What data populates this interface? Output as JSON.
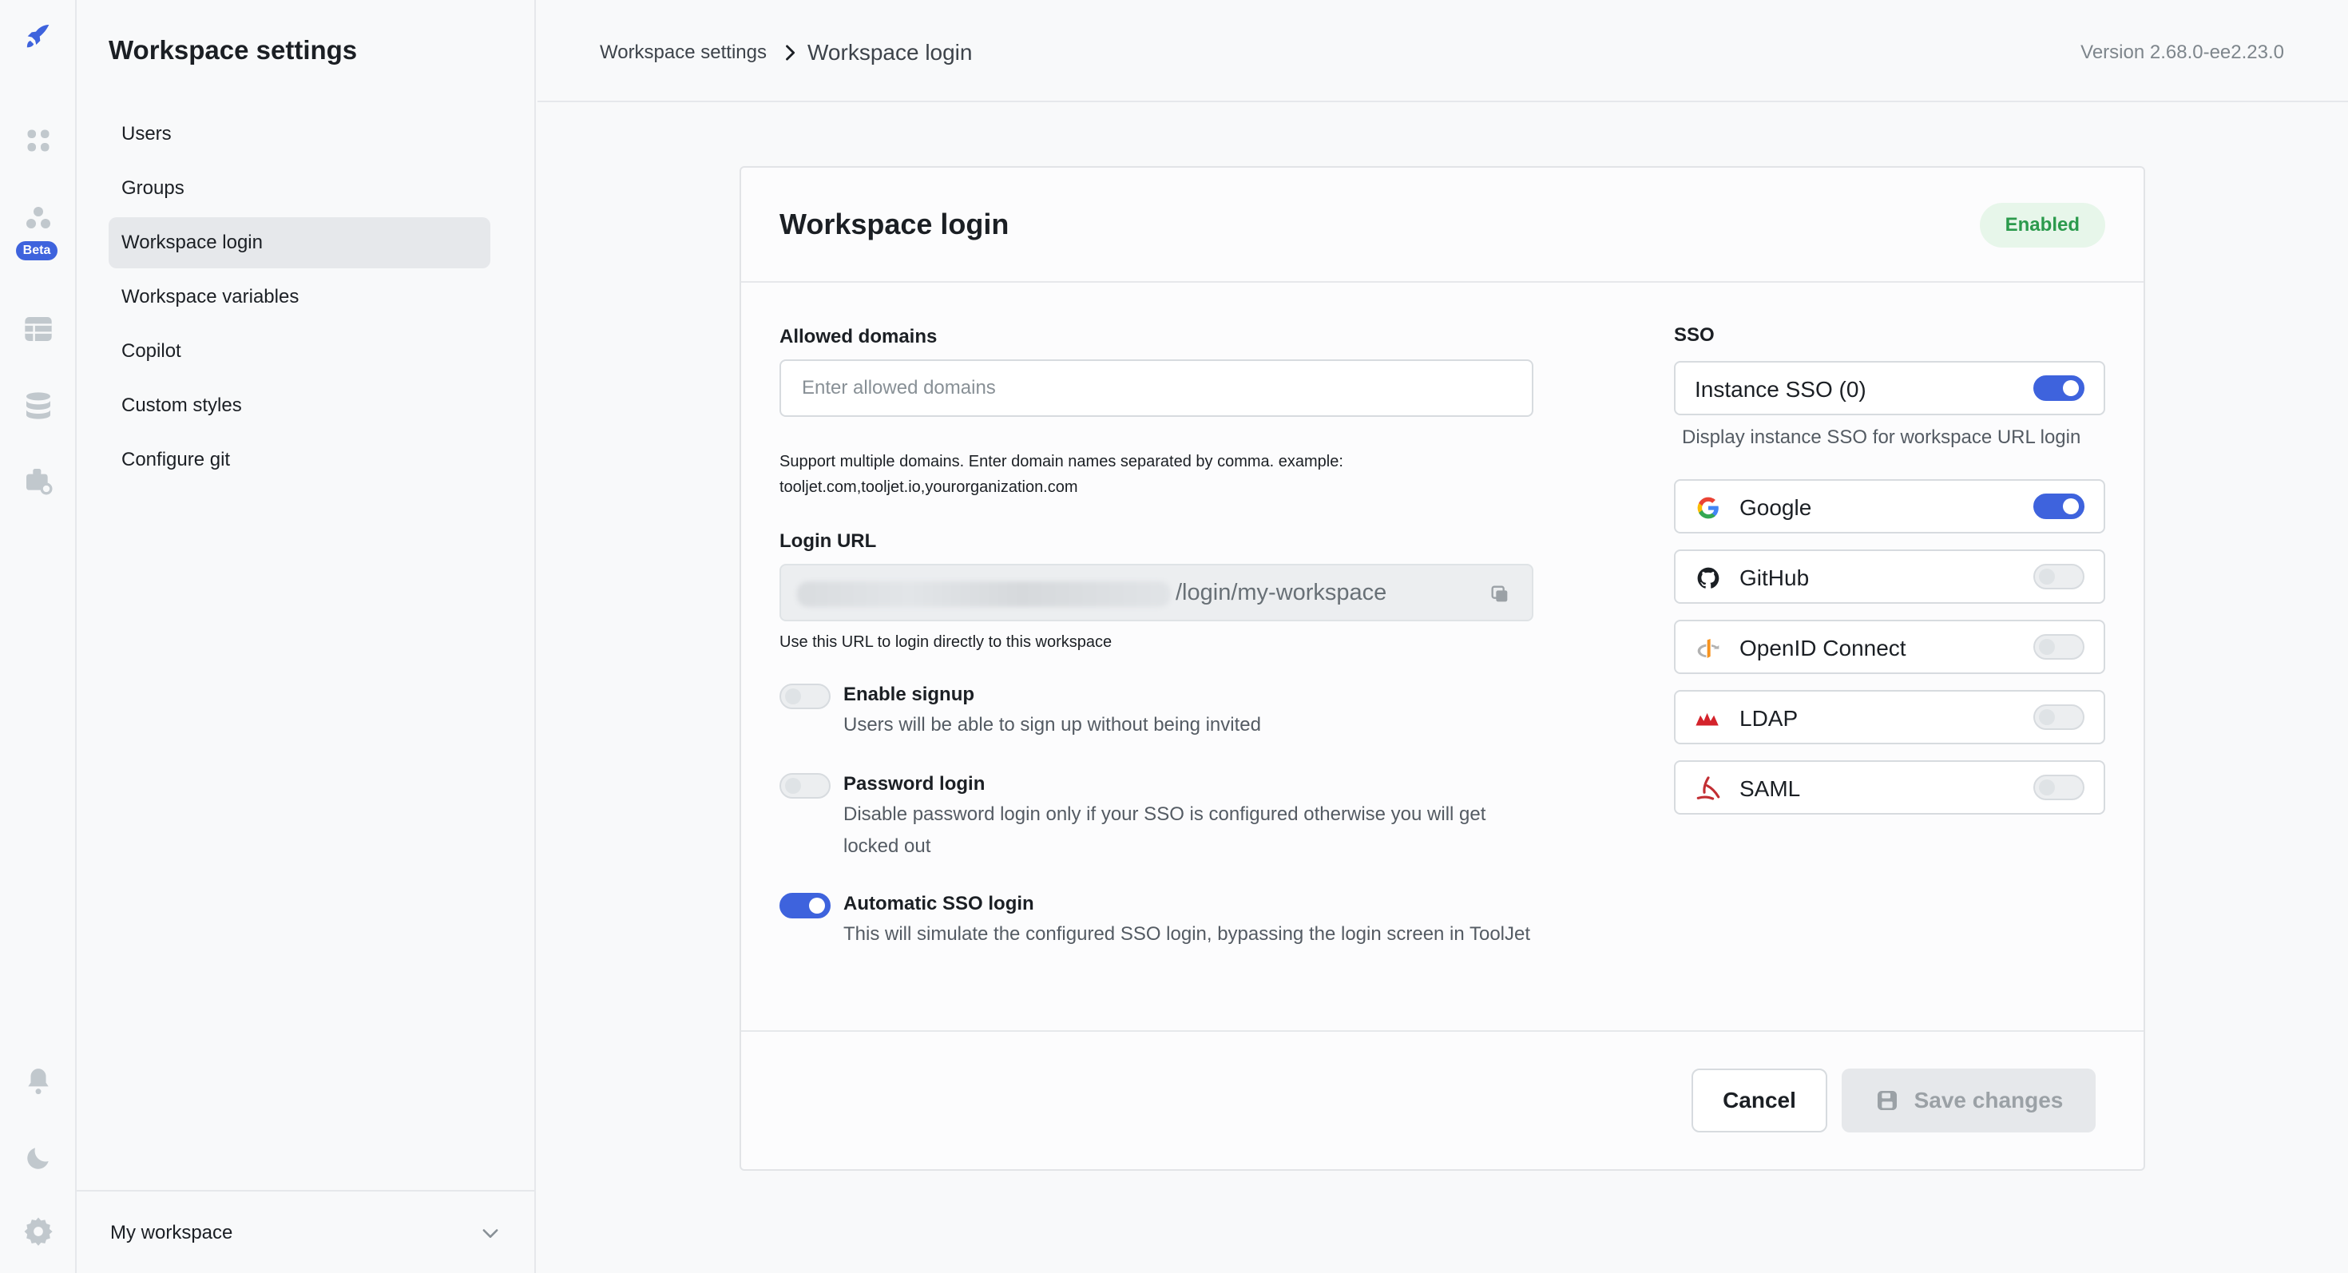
{
  "rail": {
    "beta_label": "Beta"
  },
  "sidebar": {
    "title": "Workspace settings",
    "items": [
      {
        "label": "Users"
      },
      {
        "label": "Groups"
      },
      {
        "label": "Workspace login"
      },
      {
        "label": "Workspace variables"
      },
      {
        "label": "Copilot"
      },
      {
        "label": "Custom styles"
      },
      {
        "label": "Configure git"
      }
    ],
    "active_item": "Workspace login",
    "workspace_name": "My workspace"
  },
  "header": {
    "breadcrumb_parent": "Workspace settings",
    "breadcrumb_current": "Workspace login",
    "version": "Version 2.68.0-ee2.23.0"
  },
  "card": {
    "title": "Workspace login",
    "status_badge": "Enabled",
    "allowed_domains": {
      "label": "Allowed domains",
      "placeholder": "Enter allowed domains",
      "value": "",
      "help_line1": "Support multiple domains. Enter domain names separated by comma. example:",
      "help_line2": "tooljet.com,tooljet.io,yourorganization.com"
    },
    "login_url": {
      "label": "Login URL",
      "path": "/login/my-workspace",
      "help": "Use this URL to login directly to this workspace"
    },
    "options": {
      "enable_signup": {
        "title": "Enable signup",
        "desc": "Users will be able to sign up without being invited",
        "enabled": false
      },
      "password_login": {
        "title": "Password login",
        "desc_line1": "Disable password login only if your SSO is configured otherwise you will get",
        "desc_line2": "locked out",
        "enabled": false
      },
      "automatic_sso": {
        "title": "Automatic SSO login",
        "desc": "This will simulate the configured SSO login, bypassing the login screen in ToolJet",
        "enabled": true
      }
    },
    "sso": {
      "label": "SSO",
      "instance": {
        "name": "Instance SSO (0)",
        "enabled": true,
        "hint": "Display instance SSO for workspace URL login"
      },
      "providers": [
        {
          "name": "Google",
          "icon": "google-icon",
          "enabled": true
        },
        {
          "name": "GitHub",
          "icon": "github-icon",
          "enabled": false
        },
        {
          "name": "OpenID Connect",
          "icon": "openid-icon",
          "enabled": false
        },
        {
          "name": "LDAP",
          "icon": "ldap-icon",
          "enabled": false
        },
        {
          "name": "SAML",
          "icon": "saml-icon",
          "enabled": false
        }
      ]
    },
    "footer": {
      "cancel_label": "Cancel",
      "save_label": "Save changes"
    }
  },
  "colors": {
    "accent": "#3e63dd",
    "badge_bg": "#e7f6ea",
    "badge_text": "#2b9a4c"
  }
}
